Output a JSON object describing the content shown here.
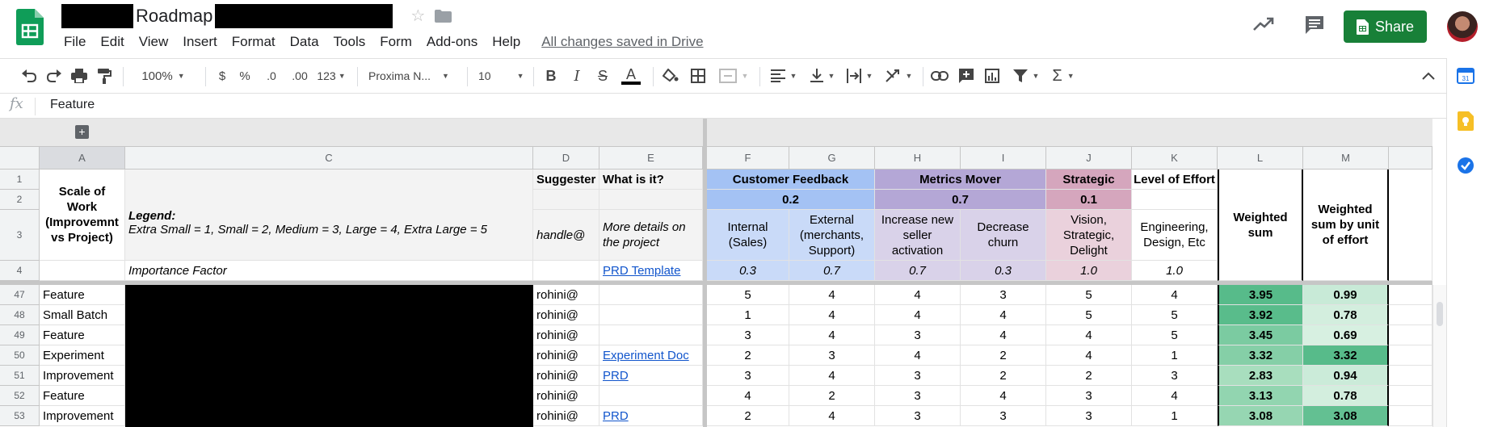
{
  "header": {
    "doc_title": "Roadmap",
    "menu": [
      "File",
      "Edit",
      "View",
      "Insert",
      "Format",
      "Data",
      "Tools",
      "Form",
      "Add-ons",
      "Help"
    ],
    "save_status": "All changes saved in Drive",
    "share_label": "Share"
  },
  "toolbar": {
    "zoom": "100%",
    "currency": "$",
    "percent": "%",
    "dec_less": ".0",
    "dec_more": ".00",
    "more_formats": "123",
    "font": "Proxima N...",
    "font_size": "10"
  },
  "formula_bar": {
    "fx_label": "fx",
    "value": "Feature"
  },
  "columns": [
    "A",
    "C",
    "D",
    "E",
    "F",
    "G",
    "H",
    "I",
    "J",
    "K",
    "L",
    "M"
  ],
  "header_rows": {
    "row_numbers": [
      "1",
      "2",
      "3",
      "4"
    ],
    "scale_of_work": "Scale of Work (Improvemnt vs Project)",
    "legend_title": "Legend:",
    "legend_text": "Extra Small = 1, Small = 2, Medium = 3, Large = 4, Extra Large = 5",
    "importance_factor": "Importance Factor",
    "suggester": "Suggester",
    "suggester_hint": "handle@",
    "what_is_it": "What is it?",
    "what_is_it_hint": "More details on the project",
    "prd_template": "PRD Template",
    "customer_feedback": "Customer Feedback",
    "customer_feedback_weight": "0.2",
    "internal": "Internal (Sales)",
    "external": "External (merchants, Support)",
    "metrics_mover": "Metrics Mover",
    "metrics_mover_weight": "0.7",
    "increase_activation": "Increase new seller activation",
    "decrease_churn": "Decrease churn",
    "strategic": "Strategic",
    "strategic_weight": "0.1",
    "vision": "Vision, Strategic, Delight",
    "level_of_effort": "Level of Effort",
    "eng_design": "Engineering, Design, Etc",
    "weighted_sum": "Weighted sum",
    "weighted_sum_effort": "Weighted sum by unit of effort",
    "factors": [
      "0.3",
      "0.7",
      "0.7",
      "0.3",
      "1.0",
      "1.0"
    ]
  },
  "rows": [
    {
      "num": "47",
      "scale": "Feature",
      "suggester": "rohini@",
      "what": "",
      "f": "5",
      "g": "4",
      "h": "4",
      "i": "3",
      "j": "5",
      "k": "4",
      "l": "3.95",
      "m": "0.99"
    },
    {
      "num": "48",
      "scale": "Small Batch",
      "suggester": "rohini@",
      "what": "",
      "f": "1",
      "g": "4",
      "h": "4",
      "i": "4",
      "j": "5",
      "k": "5",
      "l": "3.92",
      "m": "0.78"
    },
    {
      "num": "49",
      "scale": "Feature",
      "suggester": "rohini@",
      "what": "",
      "f": "3",
      "g": "4",
      "h": "3",
      "i": "4",
      "j": "4",
      "k": "5",
      "l": "3.45",
      "m": "0.69"
    },
    {
      "num": "50",
      "scale": "Experiment",
      "suggester": "rohini@",
      "what": "Experiment Doc",
      "f": "2",
      "g": "3",
      "h": "4",
      "i": "2",
      "j": "4",
      "k": "1",
      "l": "3.32",
      "m": "3.32"
    },
    {
      "num": "51",
      "scale": "Improvement",
      "suggester": "rohini@",
      "what": "PRD",
      "f": "3",
      "g": "4",
      "h": "3",
      "i": "2",
      "j": "2",
      "k": "3",
      "l": "2.83",
      "m": "0.94"
    },
    {
      "num": "52",
      "scale": "Feature",
      "suggester": "rohini@",
      "what": "",
      "f": "4",
      "g": "2",
      "h": "3",
      "i": "4",
      "j": "3",
      "k": "4",
      "l": "3.13",
      "m": "0.78"
    },
    {
      "num": "53",
      "scale": "Improvement",
      "suggester": "rohini@",
      "what": "PRD",
      "f": "2",
      "g": "4",
      "h": "3",
      "i": "3",
      "j": "3",
      "k": "1",
      "l": "3.08",
      "m": "3.08"
    }
  ],
  "colors": {
    "share_green": "#188038",
    "customer_feedback": "#a4c2f4",
    "metrics_mover": "#b4a7d6",
    "strategic": "#d5a6bd",
    "link": "#1155cc",
    "heat_scale_low": "#ffffff",
    "heat_scale_high": "#57bb8a"
  }
}
